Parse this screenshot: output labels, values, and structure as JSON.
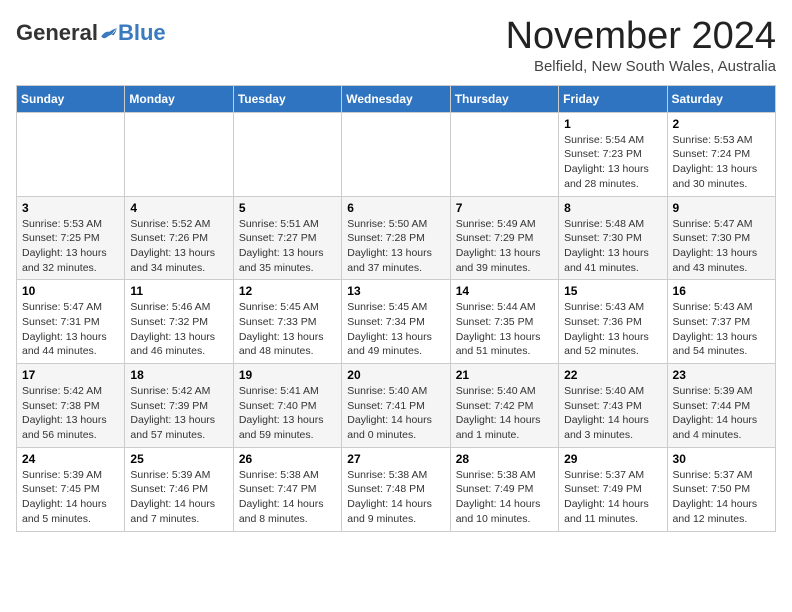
{
  "header": {
    "logo_general": "General",
    "logo_blue": "Blue",
    "month_title": "November 2024",
    "subtitle": "Belfield, New South Wales, Australia"
  },
  "days_of_week": [
    "Sunday",
    "Monday",
    "Tuesday",
    "Wednesday",
    "Thursday",
    "Friday",
    "Saturday"
  ],
  "weeks": [
    [
      {
        "day": "",
        "sunrise": "",
        "sunset": "",
        "daylight": ""
      },
      {
        "day": "",
        "sunrise": "",
        "sunset": "",
        "daylight": ""
      },
      {
        "day": "",
        "sunrise": "",
        "sunset": "",
        "daylight": ""
      },
      {
        "day": "",
        "sunrise": "",
        "sunset": "",
        "daylight": ""
      },
      {
        "day": "",
        "sunrise": "",
        "sunset": "",
        "daylight": ""
      },
      {
        "day": "1",
        "sunrise": "Sunrise: 5:54 AM",
        "sunset": "Sunset: 7:23 PM",
        "daylight": "Daylight: 13 hours and 28 minutes."
      },
      {
        "day": "2",
        "sunrise": "Sunrise: 5:53 AM",
        "sunset": "Sunset: 7:24 PM",
        "daylight": "Daylight: 13 hours and 30 minutes."
      }
    ],
    [
      {
        "day": "3",
        "sunrise": "Sunrise: 5:53 AM",
        "sunset": "Sunset: 7:25 PM",
        "daylight": "Daylight: 13 hours and 32 minutes."
      },
      {
        "day": "4",
        "sunrise": "Sunrise: 5:52 AM",
        "sunset": "Sunset: 7:26 PM",
        "daylight": "Daylight: 13 hours and 34 minutes."
      },
      {
        "day": "5",
        "sunrise": "Sunrise: 5:51 AM",
        "sunset": "Sunset: 7:27 PM",
        "daylight": "Daylight: 13 hours and 35 minutes."
      },
      {
        "day": "6",
        "sunrise": "Sunrise: 5:50 AM",
        "sunset": "Sunset: 7:28 PM",
        "daylight": "Daylight: 13 hours and 37 minutes."
      },
      {
        "day": "7",
        "sunrise": "Sunrise: 5:49 AM",
        "sunset": "Sunset: 7:29 PM",
        "daylight": "Daylight: 13 hours and 39 minutes."
      },
      {
        "day": "8",
        "sunrise": "Sunrise: 5:48 AM",
        "sunset": "Sunset: 7:30 PM",
        "daylight": "Daylight: 13 hours and 41 minutes."
      },
      {
        "day": "9",
        "sunrise": "Sunrise: 5:47 AM",
        "sunset": "Sunset: 7:30 PM",
        "daylight": "Daylight: 13 hours and 43 minutes."
      }
    ],
    [
      {
        "day": "10",
        "sunrise": "Sunrise: 5:47 AM",
        "sunset": "Sunset: 7:31 PM",
        "daylight": "Daylight: 13 hours and 44 minutes."
      },
      {
        "day": "11",
        "sunrise": "Sunrise: 5:46 AM",
        "sunset": "Sunset: 7:32 PM",
        "daylight": "Daylight: 13 hours and 46 minutes."
      },
      {
        "day": "12",
        "sunrise": "Sunrise: 5:45 AM",
        "sunset": "Sunset: 7:33 PM",
        "daylight": "Daylight: 13 hours and 48 minutes."
      },
      {
        "day": "13",
        "sunrise": "Sunrise: 5:45 AM",
        "sunset": "Sunset: 7:34 PM",
        "daylight": "Daylight: 13 hours and 49 minutes."
      },
      {
        "day": "14",
        "sunrise": "Sunrise: 5:44 AM",
        "sunset": "Sunset: 7:35 PM",
        "daylight": "Daylight: 13 hours and 51 minutes."
      },
      {
        "day": "15",
        "sunrise": "Sunrise: 5:43 AM",
        "sunset": "Sunset: 7:36 PM",
        "daylight": "Daylight: 13 hours and 52 minutes."
      },
      {
        "day": "16",
        "sunrise": "Sunrise: 5:43 AM",
        "sunset": "Sunset: 7:37 PM",
        "daylight": "Daylight: 13 hours and 54 minutes."
      }
    ],
    [
      {
        "day": "17",
        "sunrise": "Sunrise: 5:42 AM",
        "sunset": "Sunset: 7:38 PM",
        "daylight": "Daylight: 13 hours and 56 minutes."
      },
      {
        "day": "18",
        "sunrise": "Sunrise: 5:42 AM",
        "sunset": "Sunset: 7:39 PM",
        "daylight": "Daylight: 13 hours and 57 minutes."
      },
      {
        "day": "19",
        "sunrise": "Sunrise: 5:41 AM",
        "sunset": "Sunset: 7:40 PM",
        "daylight": "Daylight: 13 hours and 59 minutes."
      },
      {
        "day": "20",
        "sunrise": "Sunrise: 5:40 AM",
        "sunset": "Sunset: 7:41 PM",
        "daylight": "Daylight: 14 hours and 0 minutes."
      },
      {
        "day": "21",
        "sunrise": "Sunrise: 5:40 AM",
        "sunset": "Sunset: 7:42 PM",
        "daylight": "Daylight: 14 hours and 1 minute."
      },
      {
        "day": "22",
        "sunrise": "Sunrise: 5:40 AM",
        "sunset": "Sunset: 7:43 PM",
        "daylight": "Daylight: 14 hours and 3 minutes."
      },
      {
        "day": "23",
        "sunrise": "Sunrise: 5:39 AM",
        "sunset": "Sunset: 7:44 PM",
        "daylight": "Daylight: 14 hours and 4 minutes."
      }
    ],
    [
      {
        "day": "24",
        "sunrise": "Sunrise: 5:39 AM",
        "sunset": "Sunset: 7:45 PM",
        "daylight": "Daylight: 14 hours and 5 minutes."
      },
      {
        "day": "25",
        "sunrise": "Sunrise: 5:39 AM",
        "sunset": "Sunset: 7:46 PM",
        "daylight": "Daylight: 14 hours and 7 minutes."
      },
      {
        "day": "26",
        "sunrise": "Sunrise: 5:38 AM",
        "sunset": "Sunset: 7:47 PM",
        "daylight": "Daylight: 14 hours and 8 minutes."
      },
      {
        "day": "27",
        "sunrise": "Sunrise: 5:38 AM",
        "sunset": "Sunset: 7:48 PM",
        "daylight": "Daylight: 14 hours and 9 minutes."
      },
      {
        "day": "28",
        "sunrise": "Sunrise: 5:38 AM",
        "sunset": "Sunset: 7:49 PM",
        "daylight": "Daylight: 14 hours and 10 minutes."
      },
      {
        "day": "29",
        "sunrise": "Sunrise: 5:37 AM",
        "sunset": "Sunset: 7:49 PM",
        "daylight": "Daylight: 14 hours and 11 minutes."
      },
      {
        "day": "30",
        "sunrise": "Sunrise: 5:37 AM",
        "sunset": "Sunset: 7:50 PM",
        "daylight": "Daylight: 14 hours and 12 minutes."
      }
    ]
  ]
}
